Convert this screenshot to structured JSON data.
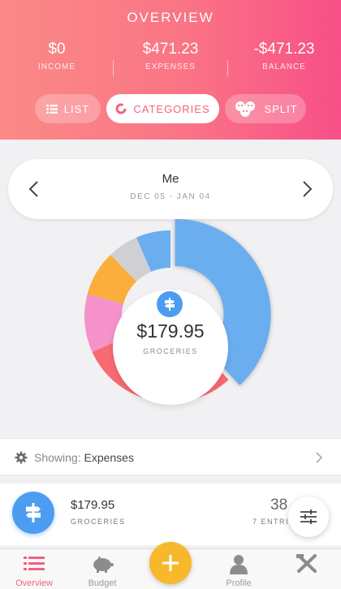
{
  "header": {
    "title": "OVERVIEW",
    "stats": [
      {
        "value": "$0",
        "label": "INCOME"
      },
      {
        "value": "$471.23",
        "label": "EXPENSES"
      },
      {
        "value": "-$471.23",
        "label": "BALANCE"
      }
    ],
    "segments": [
      {
        "label": "LIST",
        "icon": "list-icon",
        "active": false
      },
      {
        "label": "CATEGORIES",
        "icon": "donut-icon",
        "active": true
      },
      {
        "label": "SPLIT",
        "icon": "split-faces-icon",
        "active": false
      }
    ]
  },
  "period": {
    "who": "Me",
    "range": "DEC 05 - JAN 04"
  },
  "chart_data": {
    "type": "pie",
    "slices": [
      {
        "color": "#6aaeef",
        "value": 38.2
      },
      {
        "color": "#f76a73",
        "value": 30.0
      },
      {
        "color": "#f592c9",
        "value": 11.0
      },
      {
        "color": "#fbae3c",
        "value": 8.5
      },
      {
        "color": "#d0d0d2",
        "value": 5.8
      },
      {
        "color": "#6aaeef",
        "value": 6.5
      }
    ],
    "selected": {
      "amount": "$179.95",
      "label": "GROCERIES",
      "color": "#4c9df0"
    }
  },
  "showing": {
    "prefix": "Showing:",
    "value": "Expenses"
  },
  "entry": {
    "amount": "$179.95",
    "label": "GROCERIES",
    "count": "38",
    "count_label": "7 ENTRI"
  },
  "tabs": [
    {
      "label": "Overview",
      "icon": "list-icon",
      "active": true
    },
    {
      "label": "Budget",
      "icon": "piggy-bank-icon",
      "active": false
    },
    {
      "label": "",
      "icon": "plus-icon",
      "active": false
    },
    {
      "label": "Profile",
      "icon": "person-icon",
      "active": false
    },
    {
      "label": "Tools",
      "icon": "tools-icon",
      "active": false
    }
  ],
  "colors": {
    "accent": "#f2627f",
    "header_start": "#fb8a86",
    "header_end": "#f84f88",
    "blue": "#4c9df0",
    "add_button": "#f7b82c"
  }
}
